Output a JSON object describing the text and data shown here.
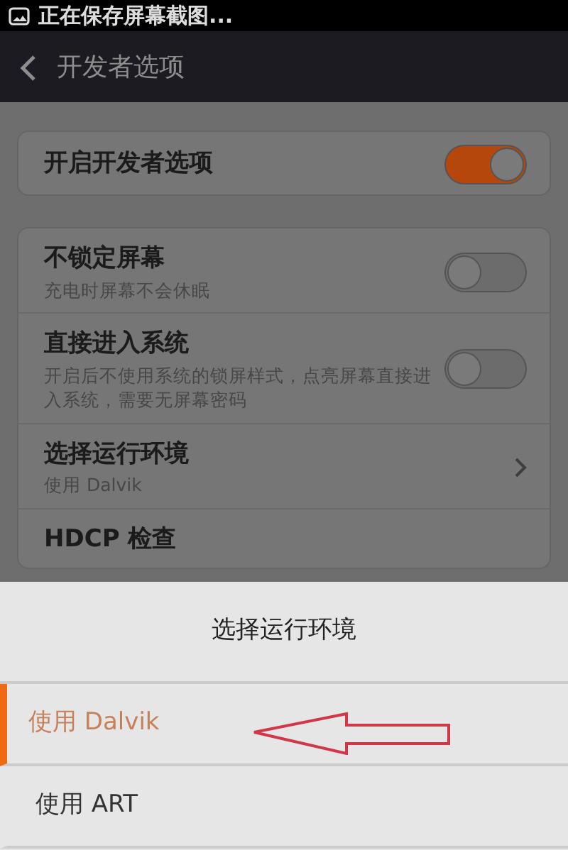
{
  "status_bar": {
    "text": "正在保存屏幕截图..."
  },
  "header": {
    "title": "开发者选项"
  },
  "settings_groups": [
    {
      "items": [
        {
          "kind": "toggle",
          "title": "开启开发者选项",
          "on": true
        }
      ]
    },
    {
      "items": [
        {
          "kind": "toggle",
          "title": "不锁定屏幕",
          "subtitle": "充电时屏幕不会休眠",
          "on": false
        },
        {
          "kind": "toggle",
          "title": "直接进入系统",
          "subtitle": "开启后不使用系统的锁屏样式，点亮屏幕直接进入系统，需要无屏幕密码",
          "on": false
        },
        {
          "kind": "link",
          "title": "选择运行环境",
          "subtitle": "使用 Dalvik"
        },
        {
          "kind": "link",
          "title": "HDCP 检查"
        }
      ]
    }
  ],
  "dialog": {
    "title": "选择运行环境",
    "options": [
      {
        "label": "使用 Dalvik",
        "selected": true
      },
      {
        "label": "使用 ART",
        "selected": false
      }
    ]
  }
}
